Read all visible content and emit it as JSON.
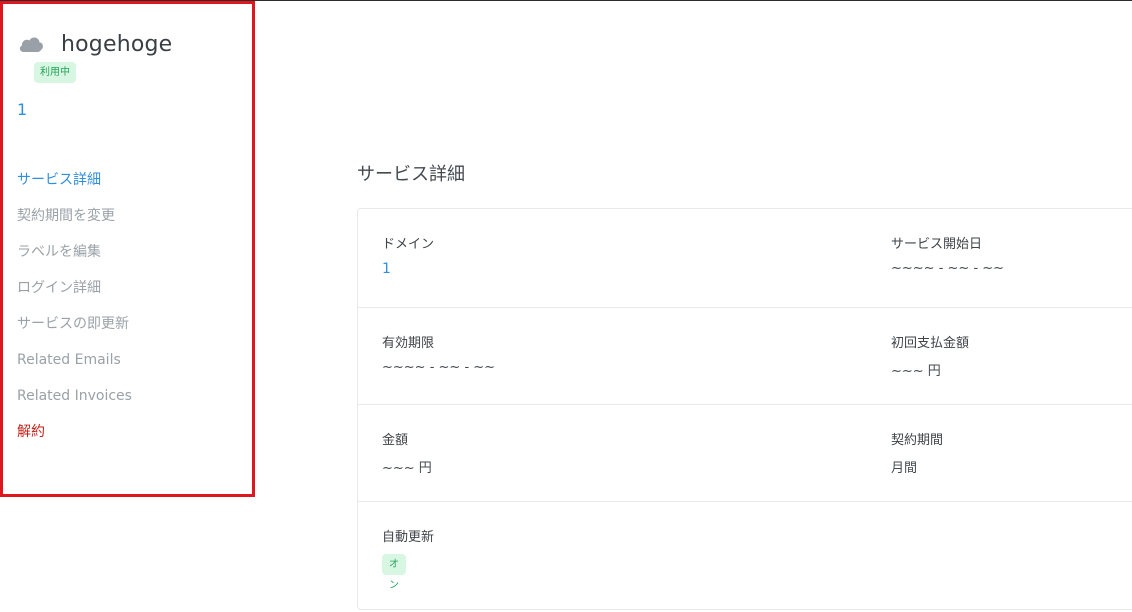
{
  "sidebar": {
    "service_name": "hogehoge",
    "status_badge": "利用中",
    "domain": "1",
    "icon": "cloud-icon",
    "items": [
      {
        "label": "サービス詳細",
        "state": "active"
      },
      {
        "label": "契約期間を変更",
        "state": "normal"
      },
      {
        "label": "ラベルを編集",
        "state": "normal"
      },
      {
        "label": "ログイン詳細",
        "state": "normal"
      },
      {
        "label": "サービスの即更新",
        "state": "normal"
      },
      {
        "label": "Related Emails",
        "state": "normal"
      },
      {
        "label": "Related Invoices",
        "state": "normal"
      },
      {
        "label": "解約",
        "state": "danger"
      }
    ]
  },
  "main": {
    "title": "サービス詳細",
    "fields": {
      "domain": {
        "label": "ドメイン",
        "value": "1"
      },
      "start_date": {
        "label": "サービス開始日",
        "value": "~~~~ - ~~ - ~~"
      },
      "expiry": {
        "label": "有効期限",
        "value": "~~~~ - ~~ - ~~"
      },
      "first_payment": {
        "label": "初回支払金額",
        "value": "~~~ 円"
      },
      "amount": {
        "label": "金額",
        "value": "~~~ 円"
      },
      "contract_period": {
        "label": "契約期間",
        "value": "月間"
      },
      "auto_renew": {
        "label": "自動更新",
        "value": "オン"
      }
    }
  },
  "colors": {
    "accent": "#2f8fdc",
    "danger": "#c1231b",
    "badge_bg": "#d7f7e2",
    "badge_text": "#27a25a",
    "highlight_border": "#e0161f"
  }
}
